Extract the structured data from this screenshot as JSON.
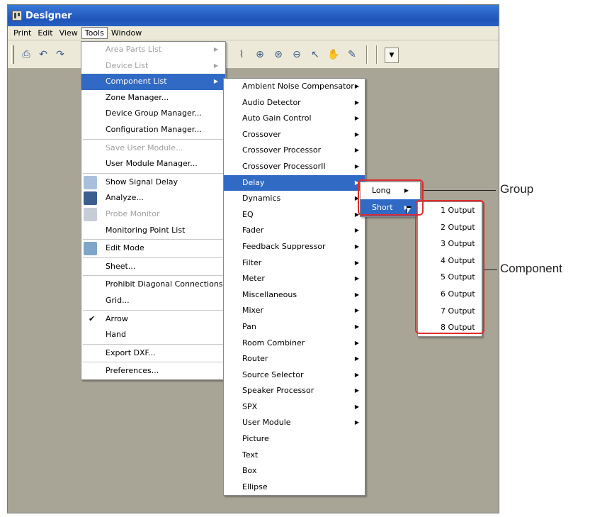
{
  "window": {
    "title": "Designer"
  },
  "menubar": [
    {
      "label": "Print"
    },
    {
      "label": "Edit"
    },
    {
      "label": "View"
    },
    {
      "label": "Tools",
      "active": true
    },
    {
      "label": "Window"
    }
  ],
  "tools_menu": [
    {
      "label": "Area Parts List",
      "disabled": true,
      "submenu": true
    },
    {
      "label": "Device List",
      "disabled": true,
      "submenu": true
    },
    {
      "label": "Component List",
      "submenu": true,
      "highlighted": true
    },
    {
      "label": "Zone Manager..."
    },
    {
      "label": "Device Group Manager..."
    },
    {
      "label": "Configuration Manager..."
    },
    {
      "separator": true
    },
    {
      "label": "Save User Module...",
      "disabled": true
    },
    {
      "label": "User Module Manager..."
    },
    {
      "separator": true
    },
    {
      "label": "Show Signal Delay",
      "icon": "signal-delay-icon"
    },
    {
      "label": "Analyze...",
      "icon": "analyze-icon"
    },
    {
      "label": "Probe Monitor",
      "icon": "probe-icon",
      "disabled": true
    },
    {
      "label": "Monitoring Point List"
    },
    {
      "separator": true
    },
    {
      "label": "Edit Mode",
      "icon": "edit-mode-icon"
    },
    {
      "separator": true
    },
    {
      "label": "Sheet..."
    },
    {
      "separator": true
    },
    {
      "label": "Prohibit Diagonal Connections"
    },
    {
      "label": "Grid..."
    },
    {
      "separator": true
    },
    {
      "label": "Arrow",
      "checked": true
    },
    {
      "label": "Hand"
    },
    {
      "separator": true
    },
    {
      "label": "Export DXF..."
    },
    {
      "separator": true
    },
    {
      "label": "Preferences..."
    }
  ],
  "component_menu": [
    {
      "label": "Ambient Noise Compensator",
      "submenu": true
    },
    {
      "label": "Audio Detector",
      "submenu": true
    },
    {
      "label": "Auto Gain Control",
      "submenu": true
    },
    {
      "label": "Crossover",
      "submenu": true
    },
    {
      "label": "Crossover Processor",
      "submenu": true
    },
    {
      "label": "Crossover ProcessorII",
      "submenu": true
    },
    {
      "label": "Delay",
      "submenu": true,
      "highlighted": true
    },
    {
      "label": "Dynamics",
      "submenu": true
    },
    {
      "label": "EQ",
      "submenu": true
    },
    {
      "label": "Fader",
      "submenu": true
    },
    {
      "label": "Feedback Suppressor",
      "submenu": true
    },
    {
      "label": "Filter",
      "submenu": true
    },
    {
      "label": "Meter",
      "submenu": true
    },
    {
      "label": "Miscellaneous",
      "submenu": true
    },
    {
      "label": "Mixer",
      "submenu": true
    },
    {
      "label": "Pan",
      "submenu": true
    },
    {
      "label": "Room Combiner",
      "submenu": true
    },
    {
      "label": "Router",
      "submenu": true
    },
    {
      "label": "Source Selector",
      "submenu": true
    },
    {
      "label": "Speaker Processor",
      "submenu": true
    },
    {
      "label": "SPX",
      "submenu": true
    },
    {
      "label": "User Module",
      "submenu": true
    },
    {
      "label": "Picture"
    },
    {
      "label": "Text"
    },
    {
      "label": "Box"
    },
    {
      "label": "Ellipse"
    }
  ],
  "group_menu": [
    {
      "label": "Long",
      "submenu": true
    },
    {
      "label": "Short",
      "submenu": true,
      "highlighted": true
    }
  ],
  "output_menu": [
    {
      "label": "1 Output"
    },
    {
      "label": "2 Output"
    },
    {
      "label": "3 Output"
    },
    {
      "label": "4 Output"
    },
    {
      "label": "5 Output"
    },
    {
      "label": "6 Output"
    },
    {
      "label": "7 Output"
    },
    {
      "label": "8 Output"
    }
  ],
  "callouts": {
    "group": "Group",
    "component": "Component"
  },
  "colors": {
    "highlight": "#316ac5",
    "callout_border": "#e22c2c",
    "titlebar": "#2a62c6"
  }
}
